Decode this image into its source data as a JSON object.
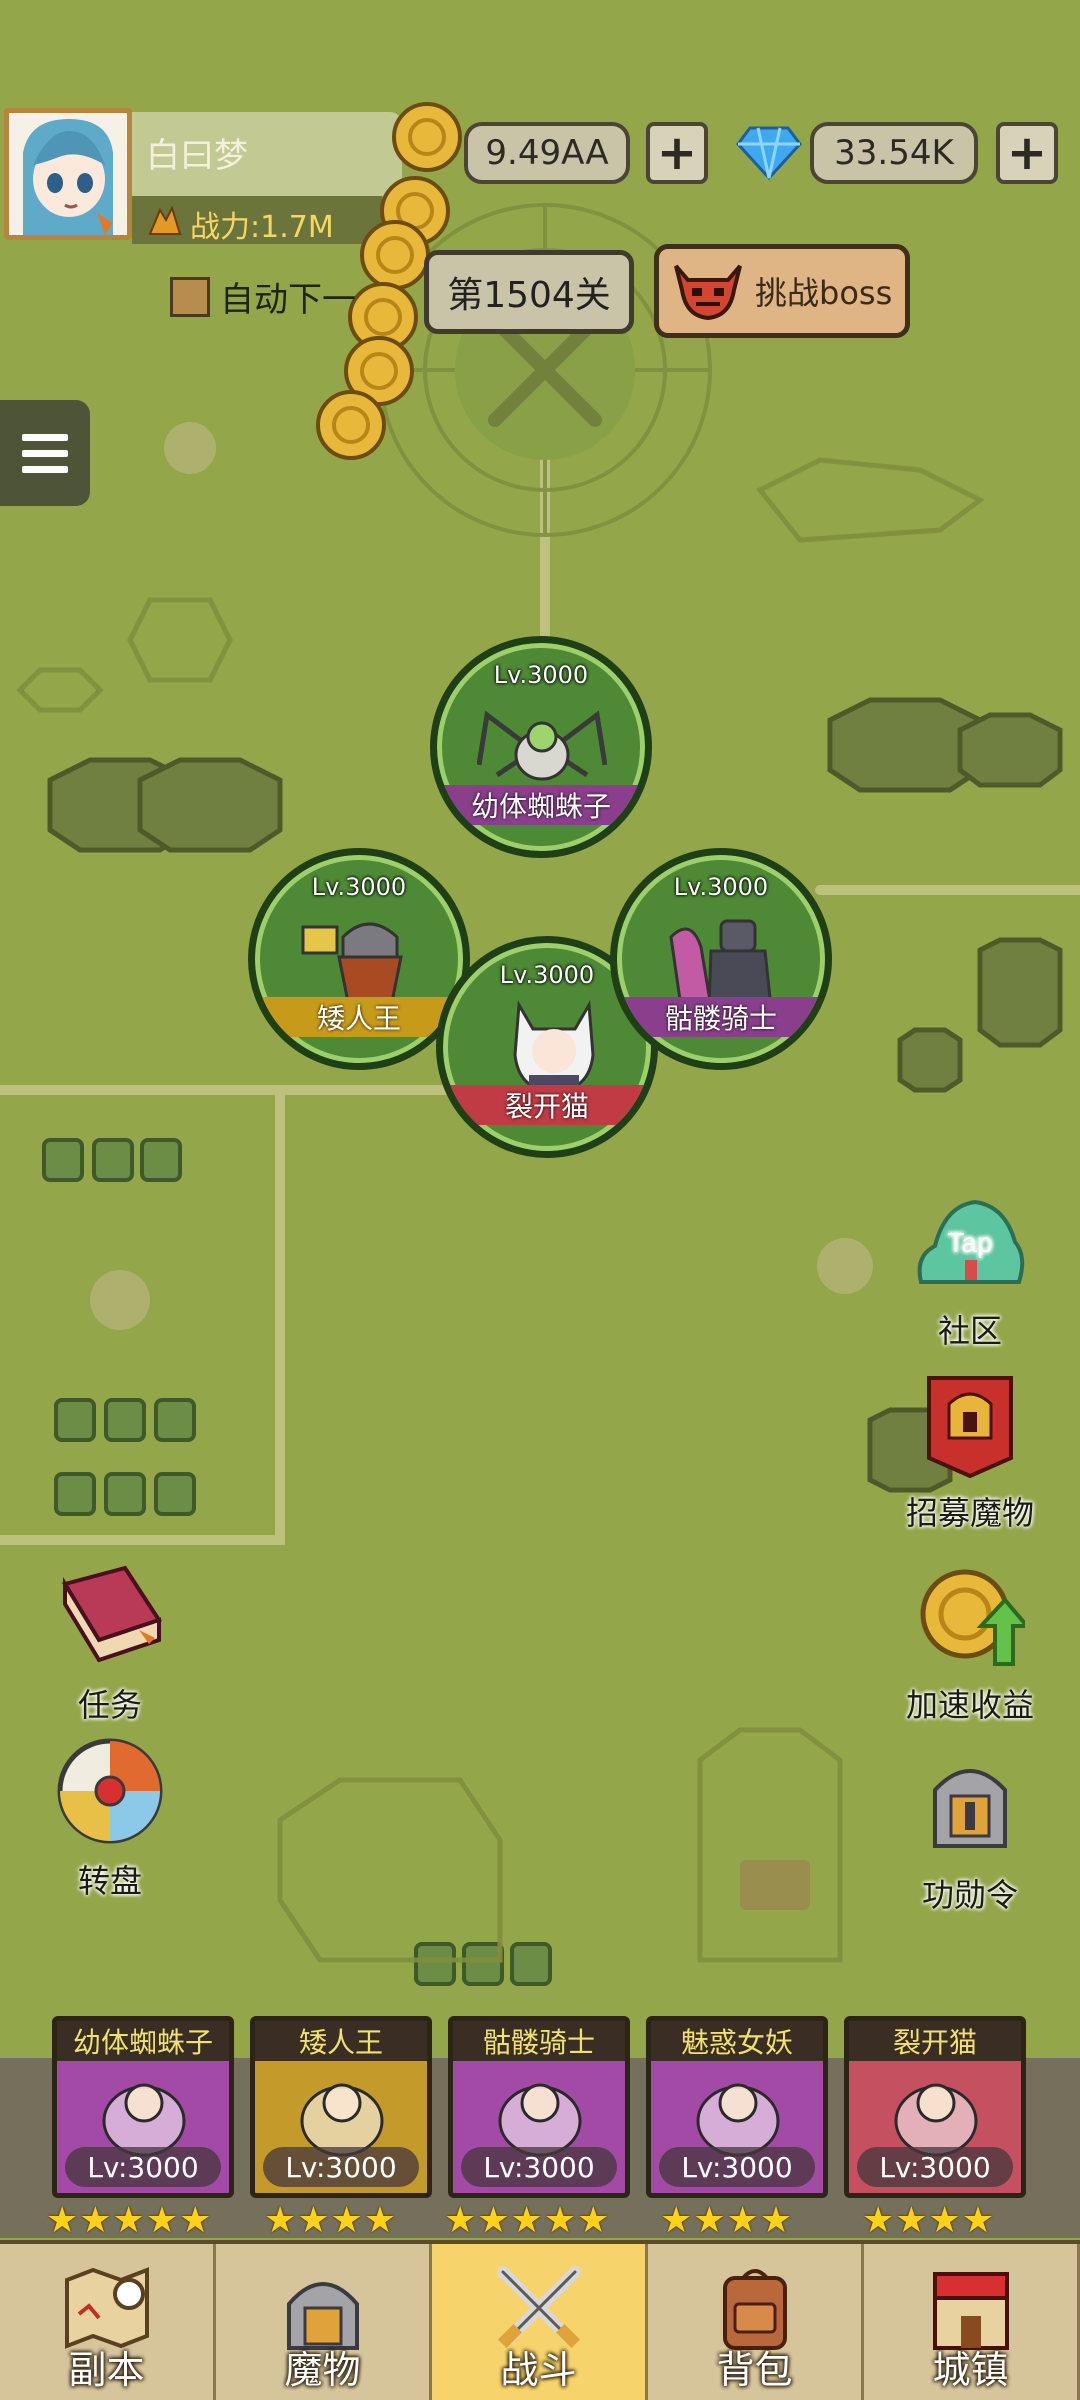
{
  "player": {
    "name": "白曰梦",
    "power": "战力:1.7M"
  },
  "resources": {
    "gold": "9.49AA",
    "gems": "33.54K"
  },
  "battle": {
    "auto_next_label": "自动下一",
    "stage_label": "第1504关",
    "boss_button_label": "挑战boss"
  },
  "units": [
    {
      "level": "Lv.3000",
      "name": "幼体蜘蛛子",
      "band_color": "#8a3f8c"
    },
    {
      "level": "Lv.3000",
      "name": "矮人王",
      "band_color": "#c89a1a"
    },
    {
      "level": "Lv.3000",
      "name": "裂开猫",
      "band_color": "#c03b44"
    },
    {
      "level": "Lv.3000",
      "name": "骷髅骑士",
      "band_color": "#8a3f8c"
    }
  ],
  "side_buttons": {
    "community": "社区",
    "community_badge": "Tap",
    "recruit": "招募魔物",
    "speed_income": "加速收益",
    "medal": "功勋令",
    "quest": "任务",
    "wheel": "转盘"
  },
  "team": [
    {
      "name": "幼体蜘蛛子",
      "level": "Lv:3000",
      "stars": "★★★★★",
      "bg": "#a24aa6"
    },
    {
      "name": "矮人王",
      "level": "Lv:3000",
      "stars": "★★★★",
      "bg": "#c49a2a"
    },
    {
      "name": "骷髅骑士",
      "level": "Lv:3000",
      "stars": "★★★★★",
      "bg": "#a24aa6"
    },
    {
      "name": "魅惑女妖",
      "level": "Lv:3000",
      "stars": "★★★★",
      "bg": "#a24aa6"
    },
    {
      "name": "裂开猫",
      "level": "Lv:3000",
      "stars": "★★★★",
      "bg": "#c45060"
    }
  ],
  "nav": {
    "tabs": [
      "副本",
      "魔物",
      "战斗",
      "背包",
      "城镇"
    ],
    "active": "战斗"
  }
}
